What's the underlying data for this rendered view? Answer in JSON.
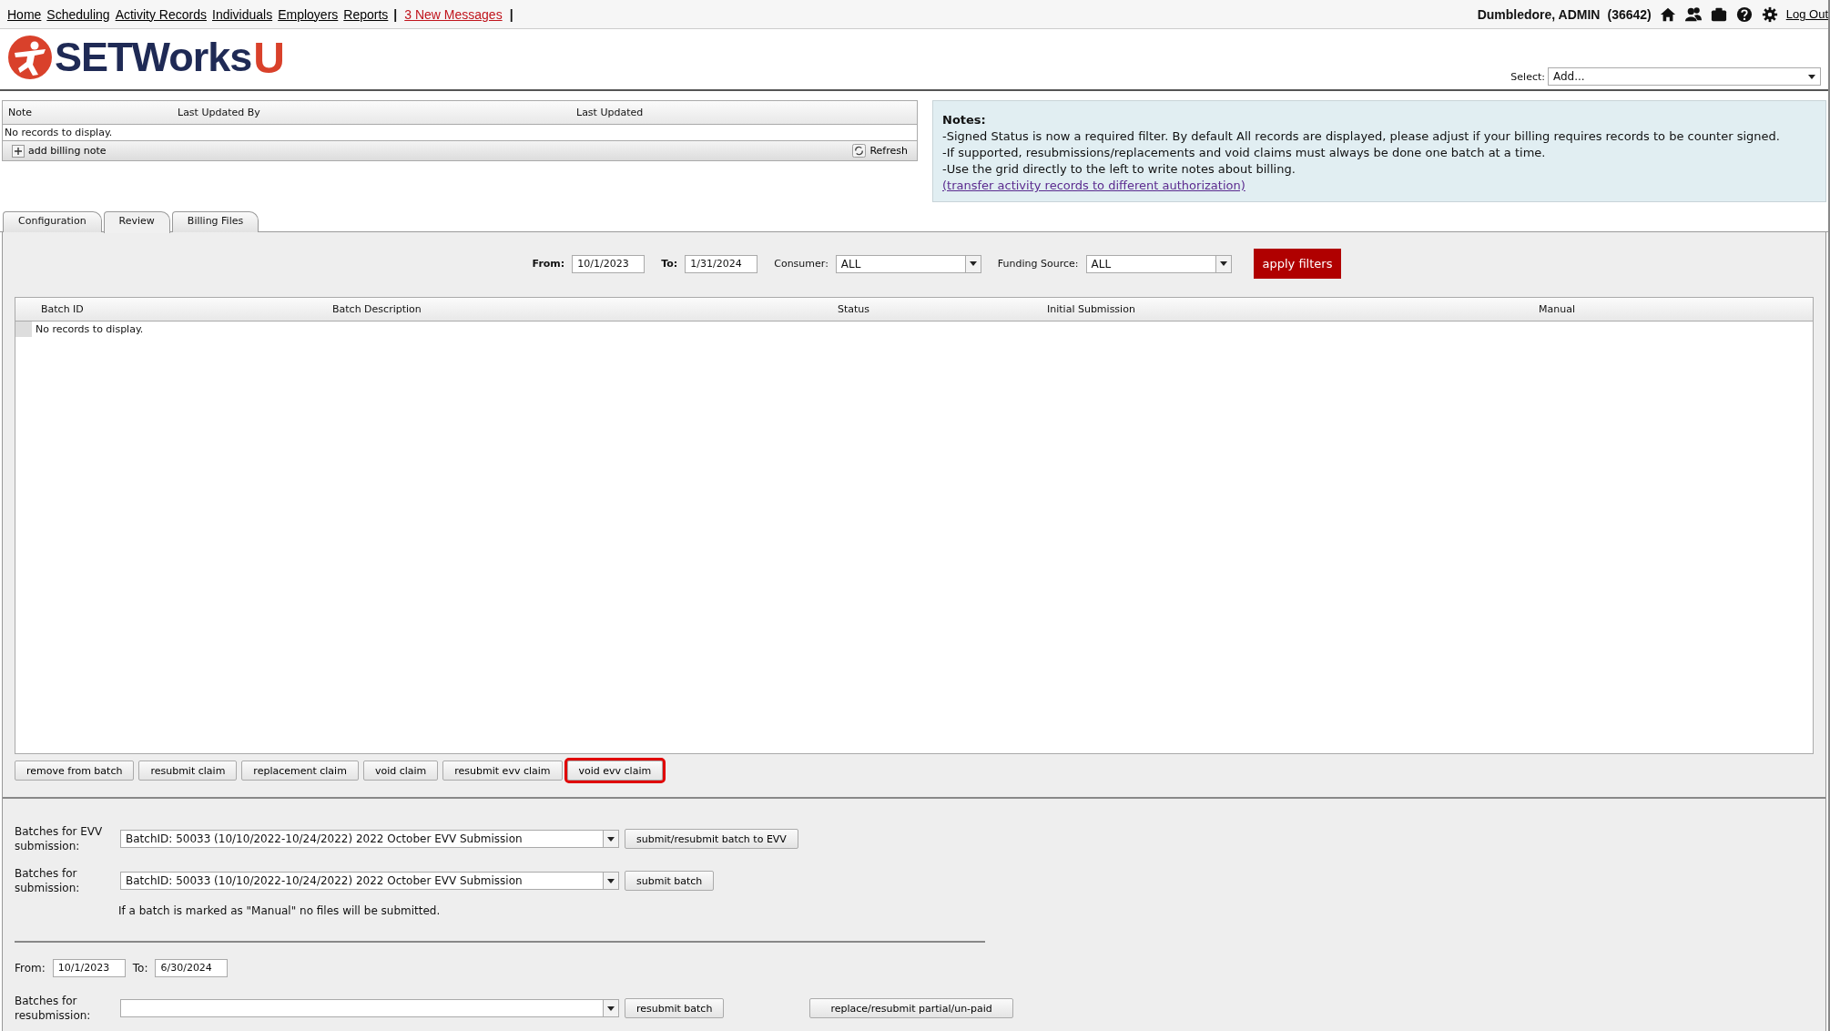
{
  "top_nav": {
    "links": [
      "Home",
      "Scheduling",
      "Activity Records",
      "Individuals",
      "Employers",
      "Reports"
    ],
    "separator": "|",
    "messages": "3 New Messages",
    "user": "Dumbledore, ADMIN",
    "user_id": "(36642)",
    "logout": "Log Out"
  },
  "logo": {
    "text": "SETWorks",
    "mark": "U"
  },
  "select": {
    "label": "Select:",
    "value": "Add..."
  },
  "notes_grid": {
    "columns": [
      "Note",
      "Last Updated By",
      "Last Updated"
    ],
    "empty": "No records to display.",
    "add_button": "add billing note",
    "refresh_button": "Refresh"
  },
  "notes_panel": {
    "title": "Notes:",
    "lines": [
      "-Signed Status is now a required filter. By default All records are displayed, please adjust if your billing requires records to be counter signed.",
      "-If supported, resubmissions/replacements and void claims must always be done one batch at a time.",
      "-Use the grid directly to the left to write notes about billing."
    ],
    "link": "(transfer activity records to different authorization)"
  },
  "tabs": [
    {
      "label": "Configuration",
      "selected": false
    },
    {
      "label": "Review",
      "selected": true
    },
    {
      "label": "Billing Files",
      "selected": false
    }
  ],
  "filters": {
    "from": {
      "label": "From:",
      "value": "10/1/2023"
    },
    "to": {
      "label": "To:",
      "value": "1/31/2024"
    },
    "consumer": {
      "label": "Consumer:",
      "value": "ALL"
    },
    "funding_source": {
      "label": "Funding Source:",
      "value": "ALL"
    },
    "apply": "apply filters"
  },
  "batch_grid": {
    "columns": [
      "Batch ID",
      "Batch Description",
      "Status",
      "Initial Submission",
      "Manual"
    ],
    "empty": "No records to display."
  },
  "actions": [
    {
      "label": "remove from batch",
      "highlighted": false
    },
    {
      "label": "resubmit claim",
      "highlighted": false
    },
    {
      "label": "replacement claim",
      "highlighted": false
    },
    {
      "label": "void claim",
      "highlighted": false
    },
    {
      "label": "resubmit evv claim",
      "highlighted": false
    },
    {
      "label": "void evv claim",
      "highlighted": true
    }
  ],
  "submissions": [
    {
      "label": "Batches for EVV submission:",
      "value": "BatchID: 50033 (10/10/2022-10/24/2022) 2022 October EVV Submission",
      "button": "submit/resubmit batch to EVV"
    },
    {
      "label": "Batches for submission:",
      "value": "BatchID: 50033 (10/10/2022-10/24/2022) 2022 October EVV Submission",
      "button": "submit batch"
    }
  ],
  "manual_note": "If a batch is marked as \"Manual\" no files will be submitted.",
  "resubmission": {
    "from": {
      "label": "From:",
      "value": "10/1/2023"
    },
    "to": {
      "label": "To:",
      "value": "6/30/2024"
    },
    "label": "Batches for resubmission:",
    "button": "resubmit batch",
    "partial_button": "replace/resubmit partial/un-paid"
  }
}
